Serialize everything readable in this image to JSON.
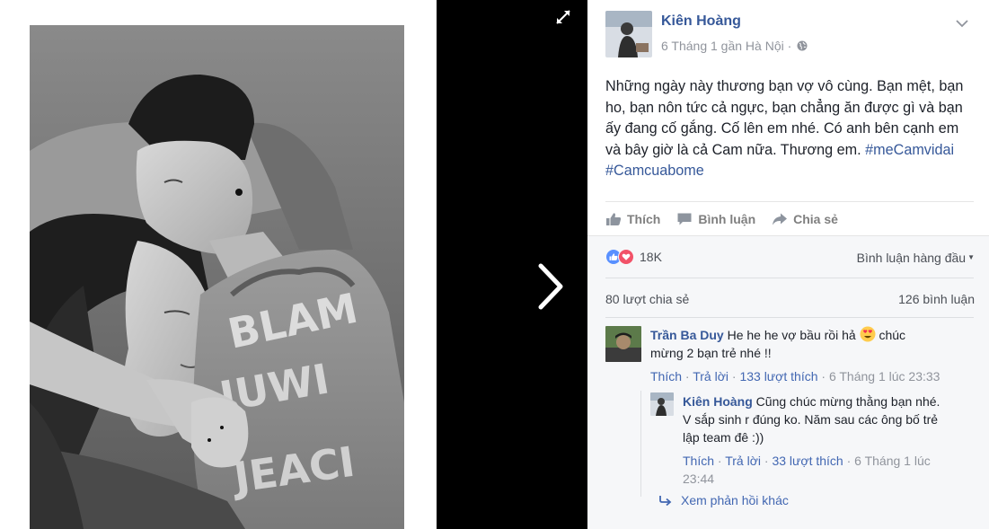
{
  "post": {
    "author": "Kiên Hoàng",
    "meta": "6 Tháng 1 gần Hà Nội ·",
    "text": "Những ngày này thương bạn vợ vô cùng. Bạn mệt, bạn ho, bạn nôn tức cả ngực, bạn chẳng ăn được gì và bạn ấy đang cố gắng. Cố lên em nhé. Có anh bên cạnh em và bây giờ là cả Cam nữa. Thương em.",
    "hashtag1": "#meCamvidai",
    "hashtag2": "#Camcuabome"
  },
  "actions": {
    "like": "Thích",
    "comment": "Bình luận",
    "share": "Chia sẻ"
  },
  "stats": {
    "reaction_count": "18K",
    "top_comments": "Bình luận hàng đầu",
    "shares": "80 lượt chia sẻ",
    "comments": "126 bình luận"
  },
  "comments": [
    {
      "name": "Trần Ba Duy",
      "text_before": "He he he vợ bầu rồi hả",
      "emoji": "heart-eyes",
      "text_after": "chúc mừng 2 bạn trẻ nhé !!",
      "like": "Thích",
      "reply": "Trả lời",
      "likes": "133 lượt thích",
      "time": "6 Tháng 1 lúc 23:33"
    }
  ],
  "reply": {
    "name": "Kiên Hoàng",
    "text": "Cũng chúc mừng thằng bạn nhé. V sắp sinh r đúng ko. Năm sau các ông bố trẻ lập team đê :))",
    "like": "Thích",
    "reply": "Trả lời",
    "likes": "33 lượt thích",
    "time": "6 Tháng 1 lúc 23:44"
  },
  "more_replies": "Xem phản hồi khác",
  "colors": {
    "link": "#365899",
    "accent": "#4267b2",
    "muted": "#90949c",
    "like_blue": "#5890ff",
    "love_red": "#f25268"
  }
}
